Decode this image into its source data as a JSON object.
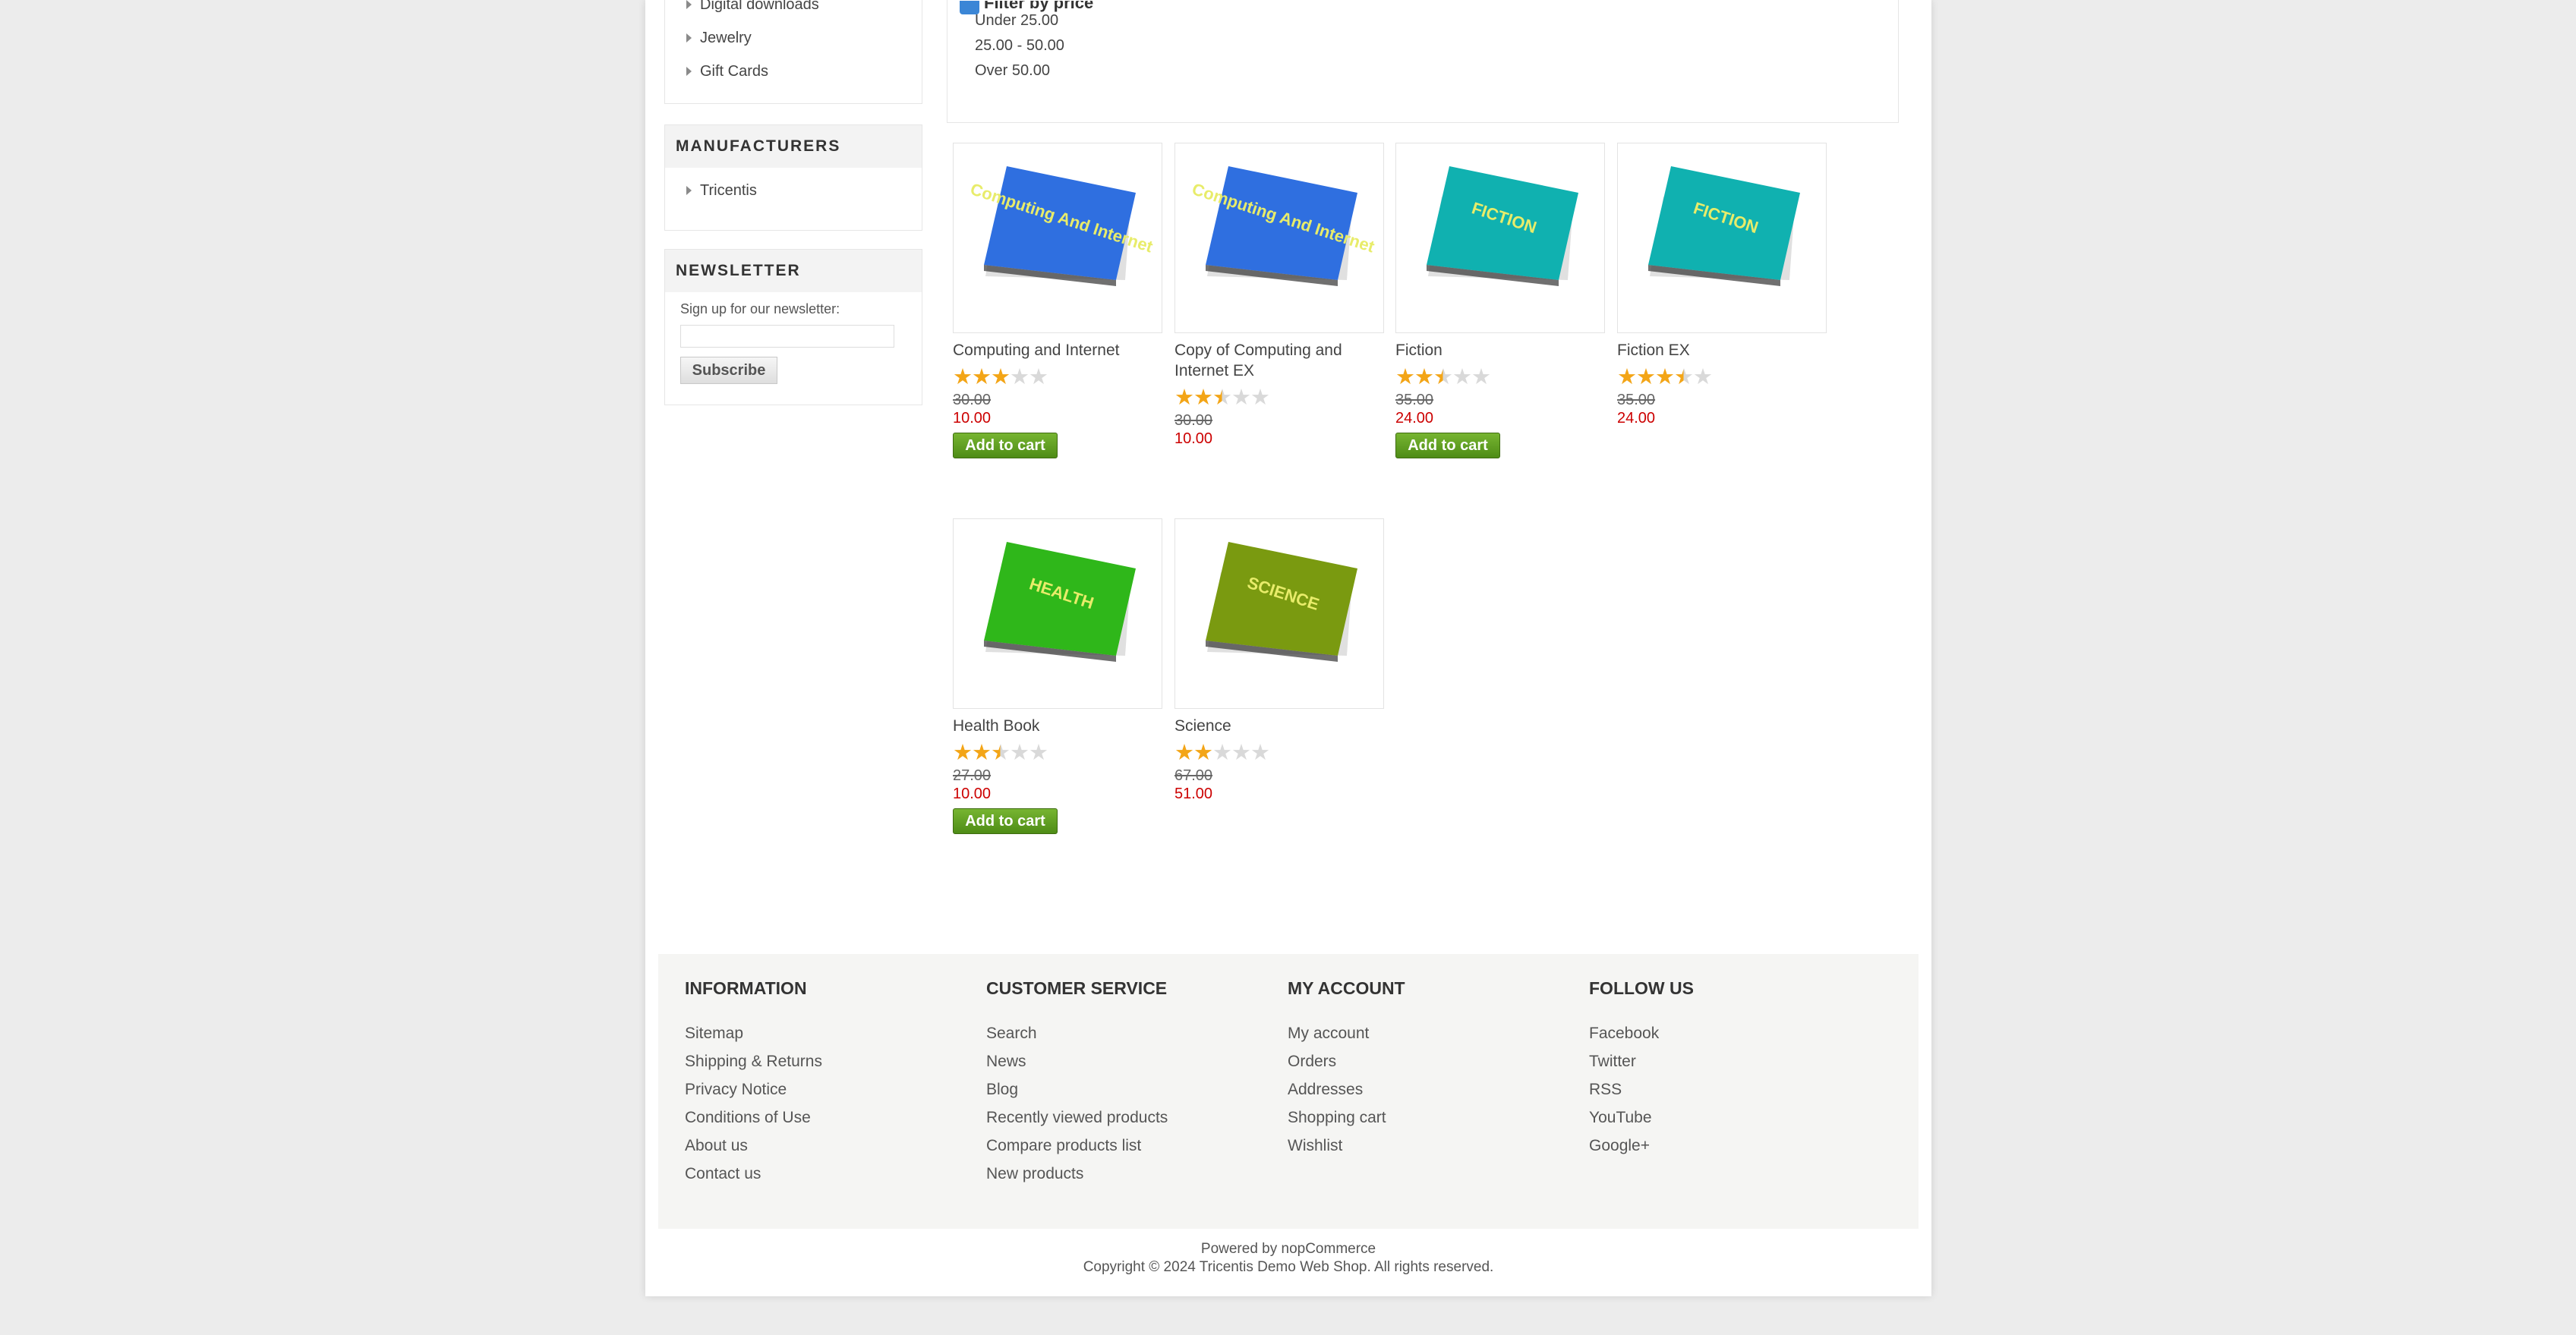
{
  "sidebar": {
    "categories": [
      "Digital downloads",
      "Jewelry",
      "Gift Cards"
    ],
    "manufacturers": {
      "title": "MANUFACTURERS",
      "items": [
        "Tricentis"
      ]
    },
    "newsletter": {
      "title": "NEWSLETTER",
      "label": "Sign up for our newsletter:",
      "button": "Subscribe",
      "input_value": ""
    }
  },
  "filter": {
    "title": "Filter by price",
    "ranges": [
      "Under 25.00",
      "25.00 - 50.00",
      "Over 50.00"
    ]
  },
  "products": [
    {
      "name": "Computing and Internet",
      "rating": 3,
      "old_price": "30.00",
      "price": "10.00",
      "cart": "Add to cart",
      "cover": "Computing And Internet",
      "color": "#2f6fe0"
    },
    {
      "name": "Copy of Computing and Internet EX",
      "rating": 2.5,
      "old_price": "30.00",
      "price": "10.00",
      "cart": "",
      "cover": "Computing And Internet",
      "color": "#2f6fe0"
    },
    {
      "name": "Fiction",
      "rating": 2.5,
      "old_price": "35.00",
      "price": "24.00",
      "cart": "Add to cart",
      "cover": "FICTION",
      "color": "#10b1b0"
    },
    {
      "name": "Fiction EX",
      "rating": 3.5,
      "old_price": "35.00",
      "price": "24.00",
      "cart": "",
      "cover": "FICTION",
      "color": "#10b1b0"
    },
    {
      "name": "Health Book",
      "rating": 2.5,
      "old_price": "27.00",
      "price": "10.00",
      "cart": "Add to cart",
      "cover": "HEALTH",
      "color": "#2fb71a"
    },
    {
      "name": "Science",
      "rating": 2,
      "old_price": "67.00",
      "price": "51.00",
      "cart": "",
      "cover": "SCIENCE",
      "color": "#7a9a10"
    }
  ],
  "footer": {
    "columns": [
      {
        "title": "INFORMATION",
        "links": [
          "Sitemap",
          "Shipping & Returns",
          "Privacy Notice",
          "Conditions of Use",
          "About us",
          "Contact us"
        ]
      },
      {
        "title": "CUSTOMER SERVICE",
        "links": [
          "Search",
          "News",
          "Blog",
          "Recently viewed products",
          "Compare products list",
          "New products"
        ]
      },
      {
        "title": "MY ACCOUNT",
        "links": [
          "My account",
          "Orders",
          "Addresses",
          "Shopping cart",
          "Wishlist"
        ]
      },
      {
        "title": "FOLLOW US",
        "links": [
          "Facebook",
          "Twitter",
          "RSS",
          "YouTube",
          "Google+"
        ]
      }
    ],
    "powered_by": "Powered by nopCommerce",
    "copyright": "Copyright © 2024 Tricentis Demo Web Shop. All rights reserved."
  }
}
